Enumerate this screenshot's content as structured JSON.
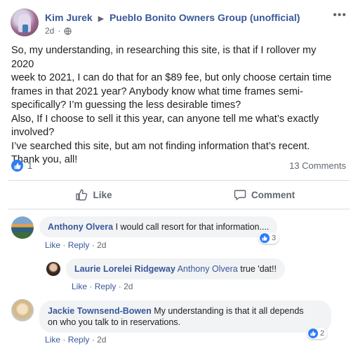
{
  "post": {
    "author": "Kim Jurek",
    "group": "Pueblo Bonito Owners Group (unofficial)",
    "timestamp": "2d",
    "body_lines": [
      "So, my understanding, in researching this site, is that if I rollover my 2020",
      "week to 2021, I can do that for an $89 fee, but only choose certain time",
      "frames in that 2021 year? Anybody know what time frames semi-",
      "specifically? I’m guessing the less desirable times?",
      "Also, If I choose to sell it this year, can anyone tell me what’s exactly",
      "involved?",
      "I’ve searched this site, but am not finding information that’s recent.",
      "Thank you, all!"
    ],
    "like_count": "1",
    "comments_count": "13 Comments"
  },
  "actions": {
    "like_label": "Like",
    "comment_label": "Comment"
  },
  "comment_actions": {
    "like": "Like",
    "reply": "Reply",
    "sep": "·"
  },
  "comments": [
    {
      "author": "Anthony Olvera",
      "text": "I would call resort for that information....",
      "time": "2d",
      "reactions": "3"
    },
    {
      "author": "Laurie Lorelei Ridgeway",
      "mention": "Anthony Olvera",
      "text": "true 'dat!!",
      "time": "2d"
    },
    {
      "author": "Jackie Townsend-Bowen",
      "text_line1": "My understanding is that it all depends",
      "text_line2": "on who you talk to in reservations.",
      "time": "2d",
      "reactions": "2"
    }
  ],
  "colors": {
    "link": "#385898",
    "meta": "#606770",
    "like_blue": "#2f7cf6",
    "bubble": "#f2f3f5"
  },
  "icons": [
    "globe-icon",
    "thumbs-up-icon",
    "comment-icon",
    "more-icon"
  ]
}
